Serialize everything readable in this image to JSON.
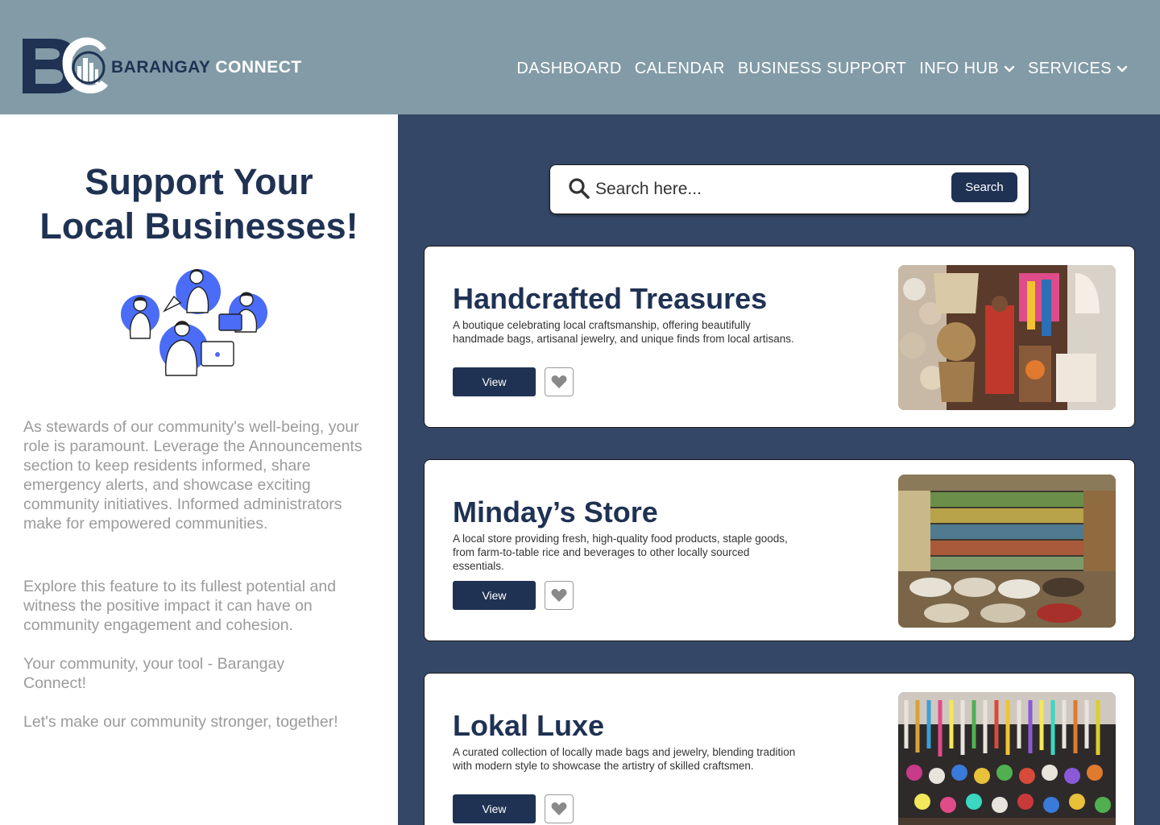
{
  "header": {
    "logo_text_part1": "BARANGAY",
    "logo_text_part2": "CONNECT",
    "nav": [
      {
        "label": "DASHBOARD"
      },
      {
        "label": "CALENDAR"
      },
      {
        "label": "BUSINESS SUPPORT"
      },
      {
        "label": "INFO HUB",
        "icon": "chevron-down-icon"
      },
      {
        "label": "SERVICES",
        "icon": "chevron-down-icon"
      }
    ]
  },
  "left_panel": {
    "title_line1": "Support Your",
    "title_line2": "Local Businesses!",
    "paragraphs": [
      "As stewards of our community's well-being, your role is paramount. Leverage the Announcements section to keep residents informed, share emergency alerts, and showcase exciting community initiatives. Informed administrators make for empowered communities.",
      "Explore this feature to its fullest potential and witness the positive impact it can have on community engagement and cohesion.",
      "Your community, your tool - Barangay Connect!",
      "Let's make our community stronger, together!"
    ]
  },
  "search": {
    "placeholder": "Search here...",
    "button_label": "Search",
    "icon": "search-icon"
  },
  "businesses": [
    {
      "name": "Handcrafted Treasures",
      "description": "A boutique celebrating local craftsmanship, offering beautifully handmade bags, artisanal jewelry, and unique finds from local artisans.",
      "view_label": "View",
      "fav_icon": "heart-icon"
    },
    {
      "name": "Minday’s Store",
      "description": "A local store providing fresh, high-quality food products, staple goods, from farm-to-table rice and beverages to other locally sourced essentials.",
      "view_label": "View",
      "fav_icon": "heart-icon"
    },
    {
      "name": "Lokal Luxe",
      "description": "A curated collection of locally made bags and jewelry, blending tradition with modern style to showcase the artistry of skilled craftsmen.",
      "view_label": "View",
      "fav_icon": "heart-icon"
    }
  ],
  "colors": {
    "header_bg": "#829ba7",
    "navy": "#1f3253",
    "panel_bg": "#354766",
    "muted_text": "#9b9b9b",
    "illustration_blue": "#4a6cf7"
  }
}
